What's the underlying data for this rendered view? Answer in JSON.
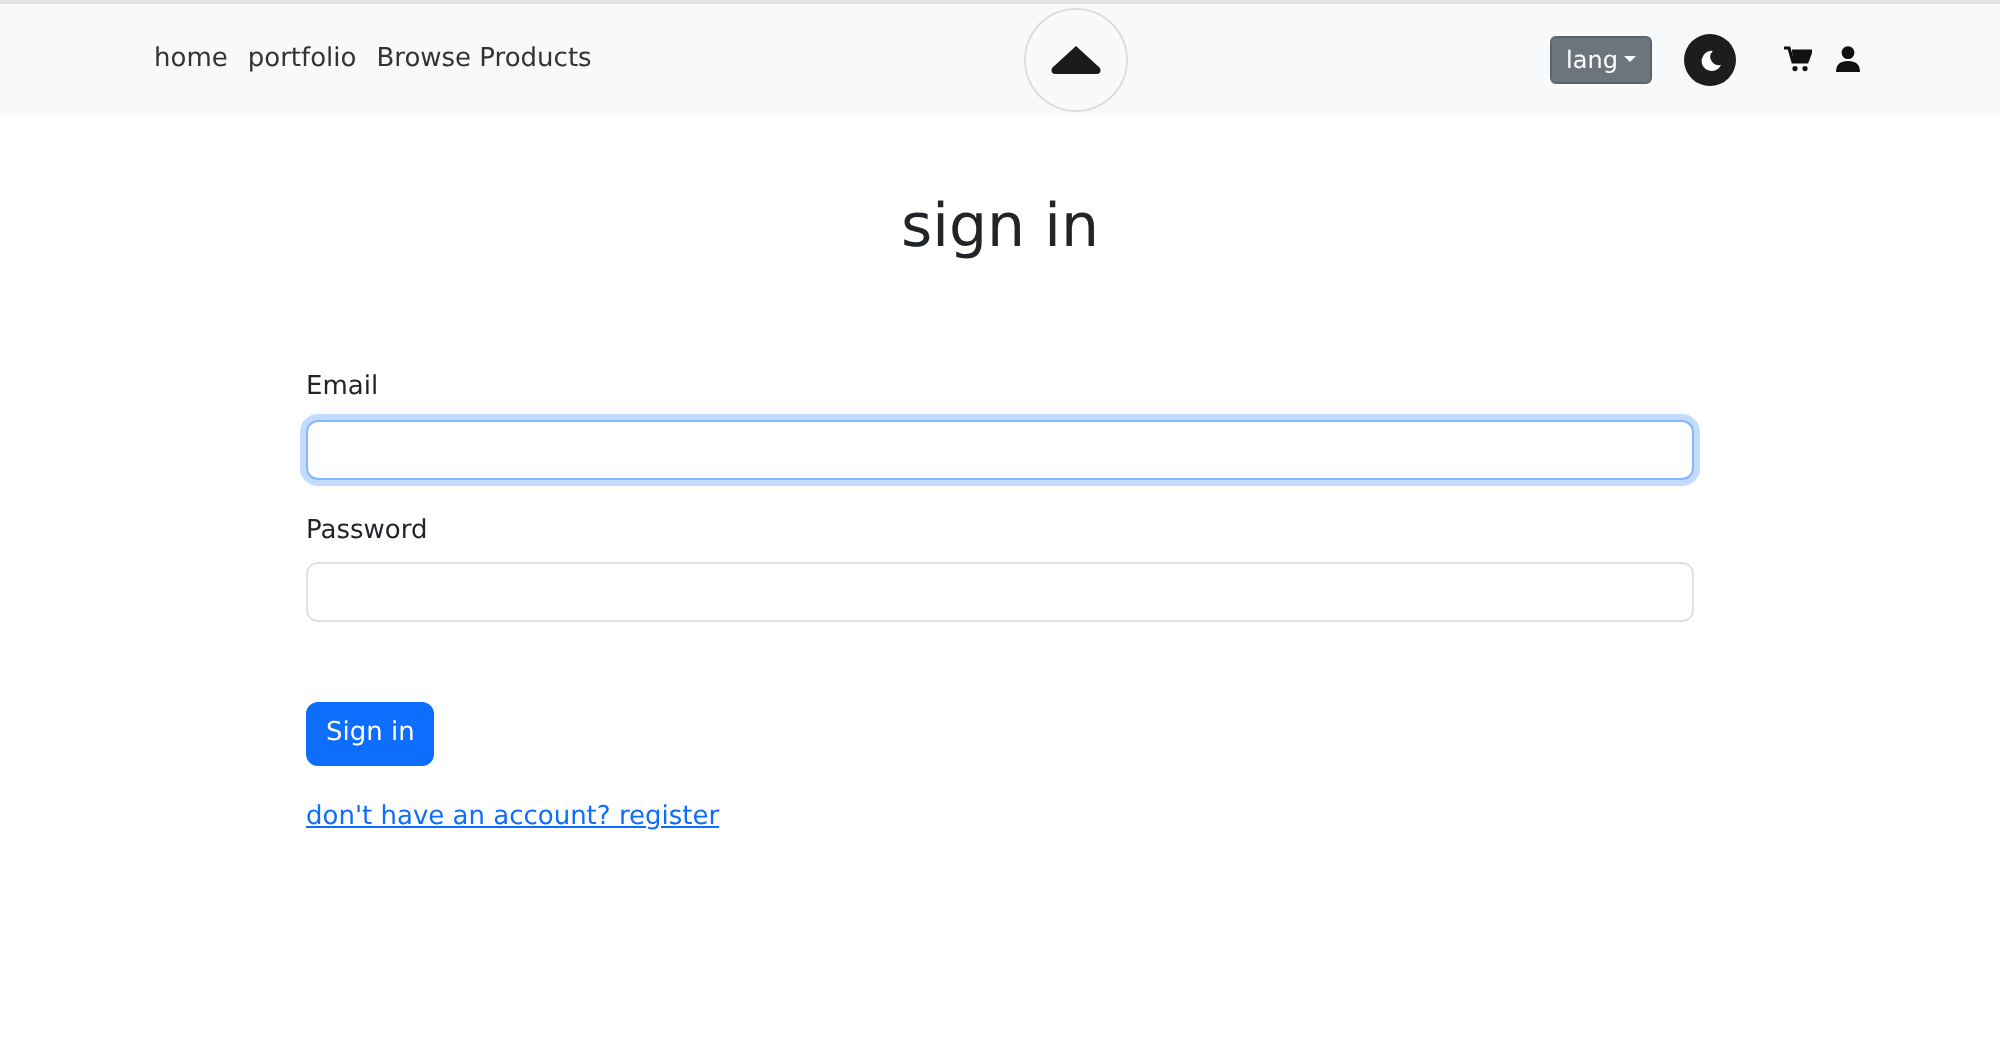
{
  "navbar": {
    "links": [
      {
        "label": "home"
      },
      {
        "label": "portfolio"
      },
      {
        "label": "Browse Products"
      }
    ],
    "language_button": {
      "label": "lang"
    },
    "dark_mode": false
  },
  "title": "sign in",
  "fields": [
    {
      "label": "Email",
      "focused": true
    },
    {
      "label": "Password",
      "focused": false
    }
  ],
  "submit_button": "Sign in",
  "register_link": "don't have an account? register"
}
